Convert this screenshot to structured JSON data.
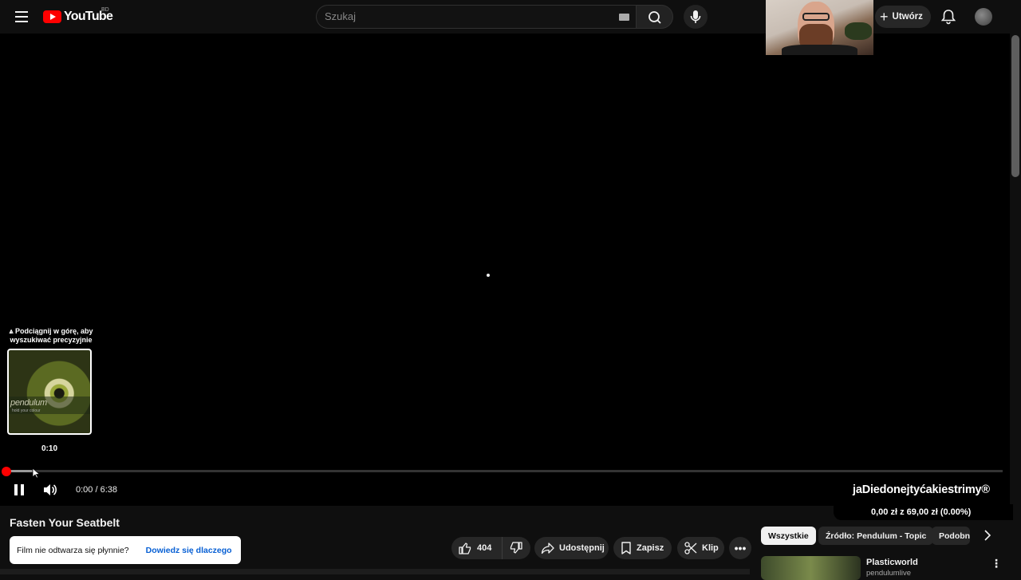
{
  "masthead": {
    "logo_text": "YouTube",
    "country_code": "BD",
    "search_placeholder": "Szukaj",
    "create_label": "Utwórz",
    "icons": [
      "menu-icon",
      "search-icon",
      "keyboard-icon",
      "mic-icon",
      "plus-icon",
      "bell-icon"
    ]
  },
  "player": {
    "seek_hint": "⩓ Podciągnij w górę, aby wyszukiwać precyzyjnie",
    "preview_time": "0:10",
    "preview_brand": "pendulum",
    "preview_subtitle": "hold your colour",
    "time_display": "0:00 / 6:38",
    "progress_fraction": 0.0,
    "overlay_text": "jaDiedonejtyćakiestrimy®",
    "donation_text": "0,00 zł z 69,00 zł (0.00%)",
    "progress_color": "#ff0000"
  },
  "video": {
    "title": "Fasten Your Seatbelt",
    "toast_message": "Film nie odtwarza się płynnie?",
    "toast_link": "Dowiedz się dlaczego",
    "like_count": "404",
    "share_label": "Udostępnij",
    "save_label": "Zapisz",
    "clip_label": "Klip",
    "more_label": "•••"
  },
  "sidebar": {
    "chips": [
      "Wszystkie",
      "Źródło: Pendulum - Topic",
      "Podobne"
    ],
    "recommendation": {
      "title": "Plasticworld",
      "channel": "pendulumlive"
    }
  }
}
